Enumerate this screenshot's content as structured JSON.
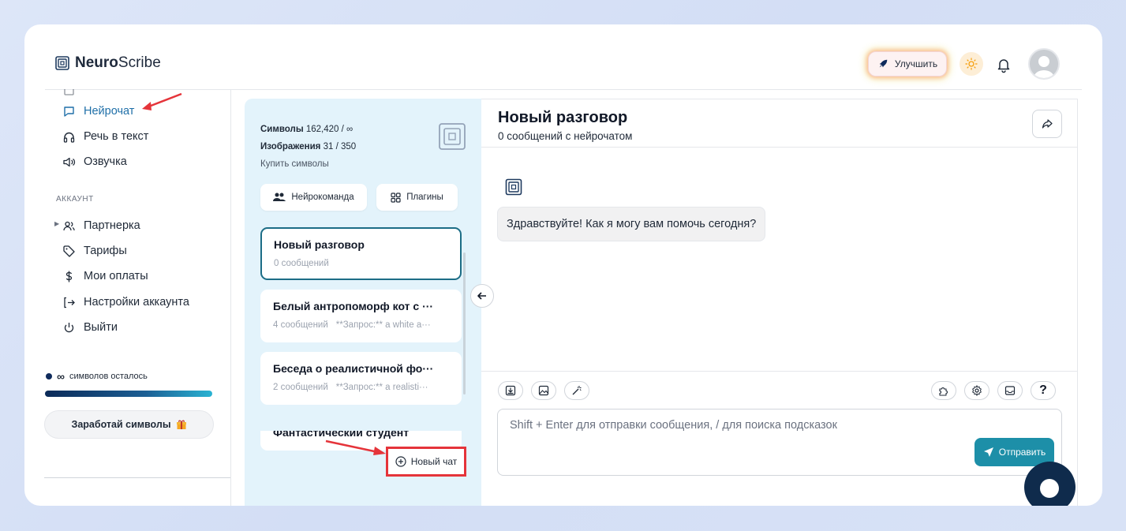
{
  "header": {
    "logo_bold": "Neuro",
    "logo_rest": "Scribe",
    "upgrade_label": "Улучшить"
  },
  "sidebar": {
    "items": [
      {
        "label": "Нейрочат",
        "icon": "chat-bubble-icon",
        "active": true
      },
      {
        "label": "Речь в текст",
        "icon": "headphones-icon"
      },
      {
        "label": "Озвучка",
        "icon": "speaker-icon"
      }
    ],
    "account_label": "АККАУНТ",
    "account_items": [
      {
        "label": "Партнерка",
        "icon": "users-icon"
      },
      {
        "label": "Тарифы",
        "icon": "tag-icon"
      },
      {
        "label": "Мои оплаты",
        "icon": "dollar-icon"
      },
      {
        "label": "Настройки аккаунта",
        "icon": "login-icon"
      },
      {
        "label": "Выйти",
        "icon": "power-icon"
      }
    ],
    "symbols_left_prefix": "∞",
    "symbols_left_text": "символов осталось",
    "progress": 1.0,
    "earn_label": "Заработай символы"
  },
  "list": {
    "symbols_label": "Символы",
    "symbols_value": "162,420 / ∞",
    "images_label": "Изображения",
    "images_value": "31 / 350",
    "buy_label": "Купить символы",
    "team_label": "Нейрокоманда",
    "plugins_label": "Плагины",
    "chats": [
      {
        "title": "Новый разговор",
        "count": "0 сообщений",
        "preview": ""
      },
      {
        "title": "Белый антропоморф кот с ···",
        "count": "4 сообщений",
        "preview": "**Запрос:** a white a···"
      },
      {
        "title": "Беседа о реалистичной фо···",
        "count": "2 сообщений",
        "preview": "**Запрос:** a realisti···"
      },
      {
        "title": "Фантастический студент",
        "count": "",
        "preview": ""
      }
    ],
    "new_chat_label": "Новый чат"
  },
  "main": {
    "title": "Новый разговор",
    "subtitle": "0 сообщений с нейрочатом",
    "greeting": "Здравствуйте! Как я могу вам помочь сегодня?",
    "input_placeholder": "Shift + Enter для отправки сообщения, / для поиска подсказок",
    "send_label": "Отправить",
    "help_label": "?"
  },
  "colors": {
    "accent": "#1d8fa8",
    "active_nav": "#1f6fa8",
    "annotation_red": "#e5343a",
    "panel_bg": "#e3f3fb"
  }
}
